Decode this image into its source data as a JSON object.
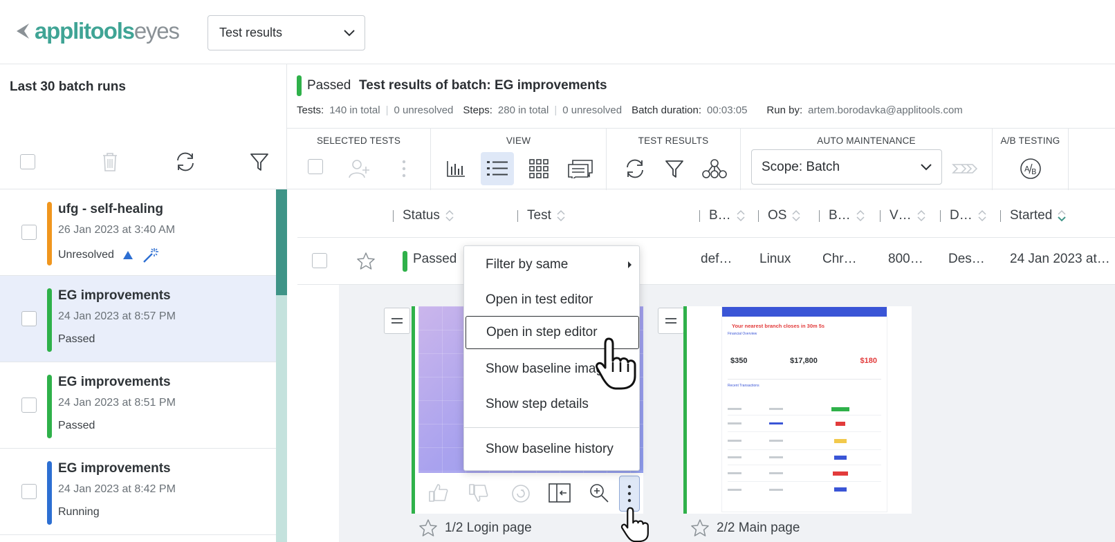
{
  "app": {
    "logo_main": "applitools",
    "logo_sub": "eyes"
  },
  "header": {
    "view_select": "Test results"
  },
  "left_panel": {
    "title": "Last 30 batch runs",
    "batches": [
      {
        "name": "ufg - self-healing",
        "date": "26 Jan 2023 at 3:40 AM",
        "status": "Unresolved",
        "color": "#f0961e"
      },
      {
        "name": "EG improvements",
        "date": "24 Jan 2023 at 8:57 PM",
        "status": "Passed",
        "color": "#2fb14a"
      },
      {
        "name": "EG improvements",
        "date": "24 Jan 2023 at 8:51 PM",
        "status": "Passed",
        "color": "#2fb14a"
      },
      {
        "name": "EG improvements",
        "date": "24 Jan 2023 at 8:42 PM",
        "status": "Running",
        "color": "#2d6fd2"
      }
    ]
  },
  "summary": {
    "status": "Passed",
    "title": "Test results of batch:  EG improvements",
    "tests_label": "Tests:",
    "tests_total": "140 in total",
    "tests_unresolved": "0 unresolved",
    "steps_label": "Steps:",
    "steps_total": "280 in total",
    "steps_unresolved": "0 unresolved",
    "duration_label": "Batch duration:",
    "duration": "00:03:05",
    "runby_label": "Run by:",
    "runby": "artem.borodavka@applitools.com"
  },
  "toolbar": {
    "selected_tests": "SELECTED TESTS",
    "view": "VIEW",
    "test_results": "TEST RESULTS",
    "auto_maintenance": "AUTO MAINTENANCE",
    "ab_testing": "A/B TESTING",
    "scope": "Scope: Batch"
  },
  "table": {
    "columns": [
      "Status",
      "Test",
      "B…",
      "OS",
      "B…",
      "V…",
      "D…",
      "Started"
    ],
    "row": {
      "status": "Passed",
      "branch": "def…",
      "os": "Linux",
      "browser": "Chr…",
      "viewport": "800…",
      "device": "Des…",
      "started": "24 Jan 2023 at…"
    }
  },
  "steps": [
    {
      "label": "1/2 Login page"
    },
    {
      "label": "2/2 Main page"
    }
  ],
  "context_menu": {
    "items": [
      "Filter by same",
      "Open in test editor",
      "Open in step editor",
      "Show baseline image",
      "Show step details",
      "Show baseline history"
    ]
  },
  "mini_dashboard": {
    "banner": "Your nearest branch closes in 30m 5s",
    "section": "Financial Overview",
    "total_balance": "$350",
    "credit_available": "$17,800",
    "due_today": "$180",
    "transactions_title": "Recent Transactions"
  }
}
